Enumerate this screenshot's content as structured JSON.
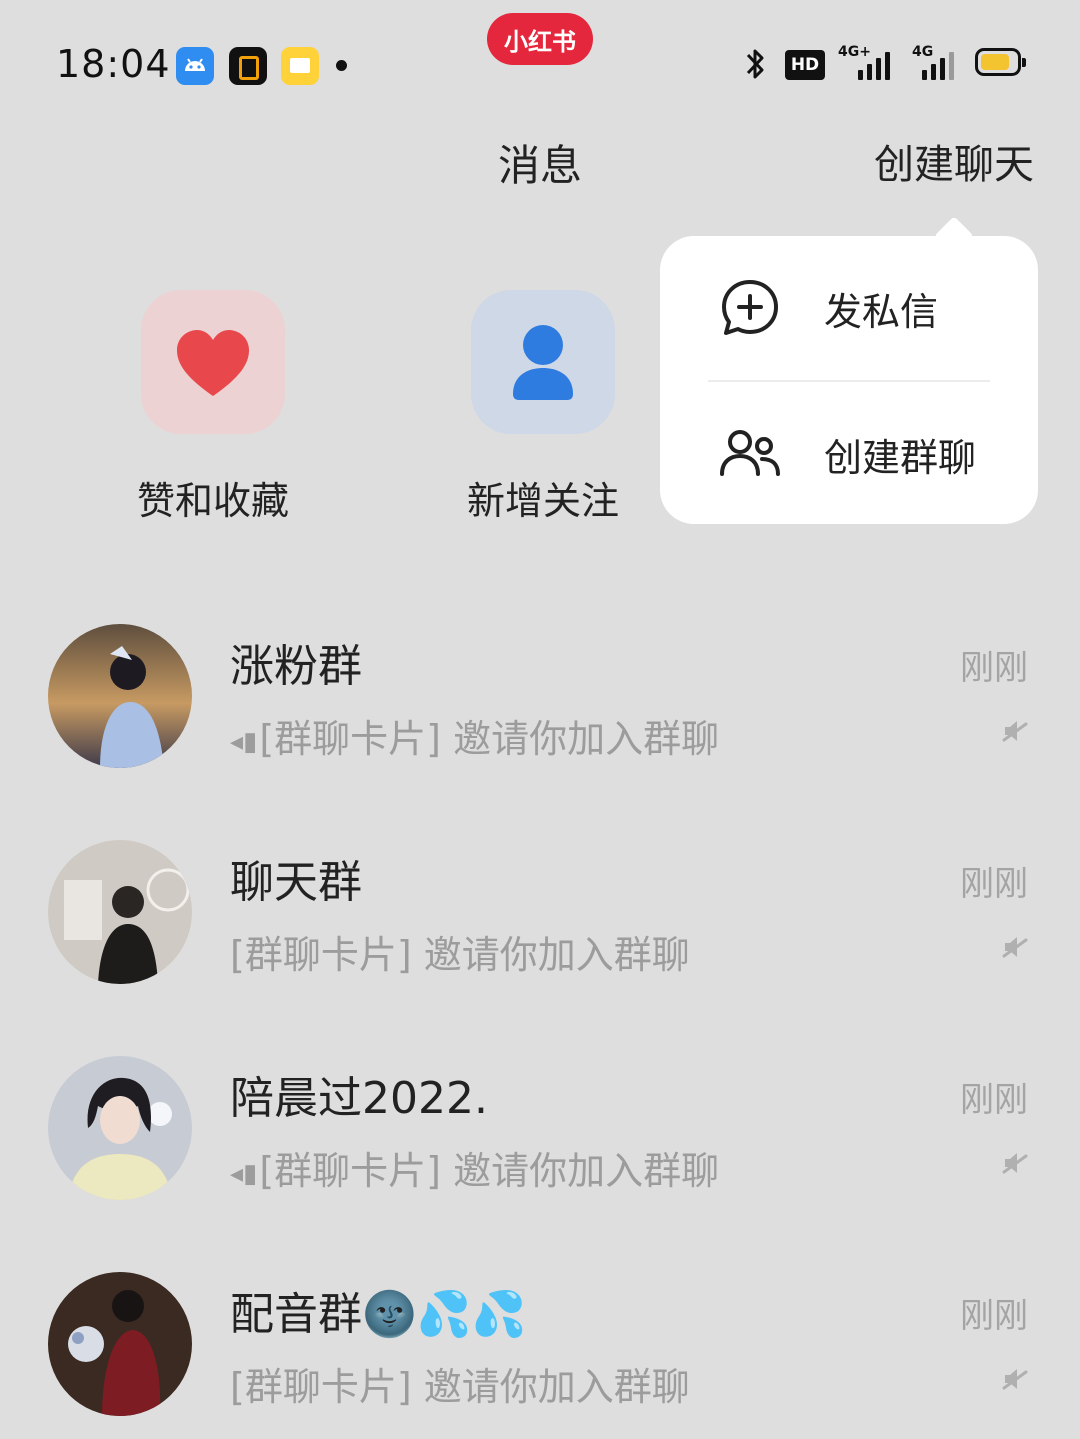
{
  "status_bar": {
    "time": "18:04",
    "brand_badge": "小红书",
    "network_1": "4G+",
    "network_2": "4G",
    "hd_label": "HD",
    "icons": [
      "android-icon",
      "o-app-icon",
      "book-app-icon",
      "bluetooth-icon",
      "signal-icon",
      "battery-icon"
    ],
    "battery_color": "#f4c430"
  },
  "header": {
    "title": "消息",
    "create_chat": "创建聊天"
  },
  "quick_entries": [
    {
      "label": "赞和收藏",
      "icon": "heart-icon",
      "color": "#e8484c"
    },
    {
      "label": "新增关注",
      "icon": "person-icon",
      "color": "#2f7ce0"
    }
  ],
  "popover": {
    "items": [
      {
        "label": "发私信",
        "icon": "add-message-icon"
      },
      {
        "label": "创建群聊",
        "icon": "group-icon"
      }
    ]
  },
  "conversations": [
    {
      "name": "涨粉群",
      "time": "刚刚",
      "preview": "[群聊卡片] 邀请你加入群聊",
      "replied": true,
      "muted": true
    },
    {
      "name": "聊天群",
      "time": "刚刚",
      "preview": "[群聊卡片] 邀请你加入群聊",
      "replied": false,
      "muted": true
    },
    {
      "name": "陪晨过2022.",
      "time": "刚刚",
      "preview": "[群聊卡片] 邀请你加入群聊",
      "replied": true,
      "muted": true
    },
    {
      "name": "配音群🌚💦💦",
      "time": "刚刚",
      "preview": "[群聊卡片] 邀请你加入群聊",
      "replied": false,
      "muted": true
    }
  ]
}
